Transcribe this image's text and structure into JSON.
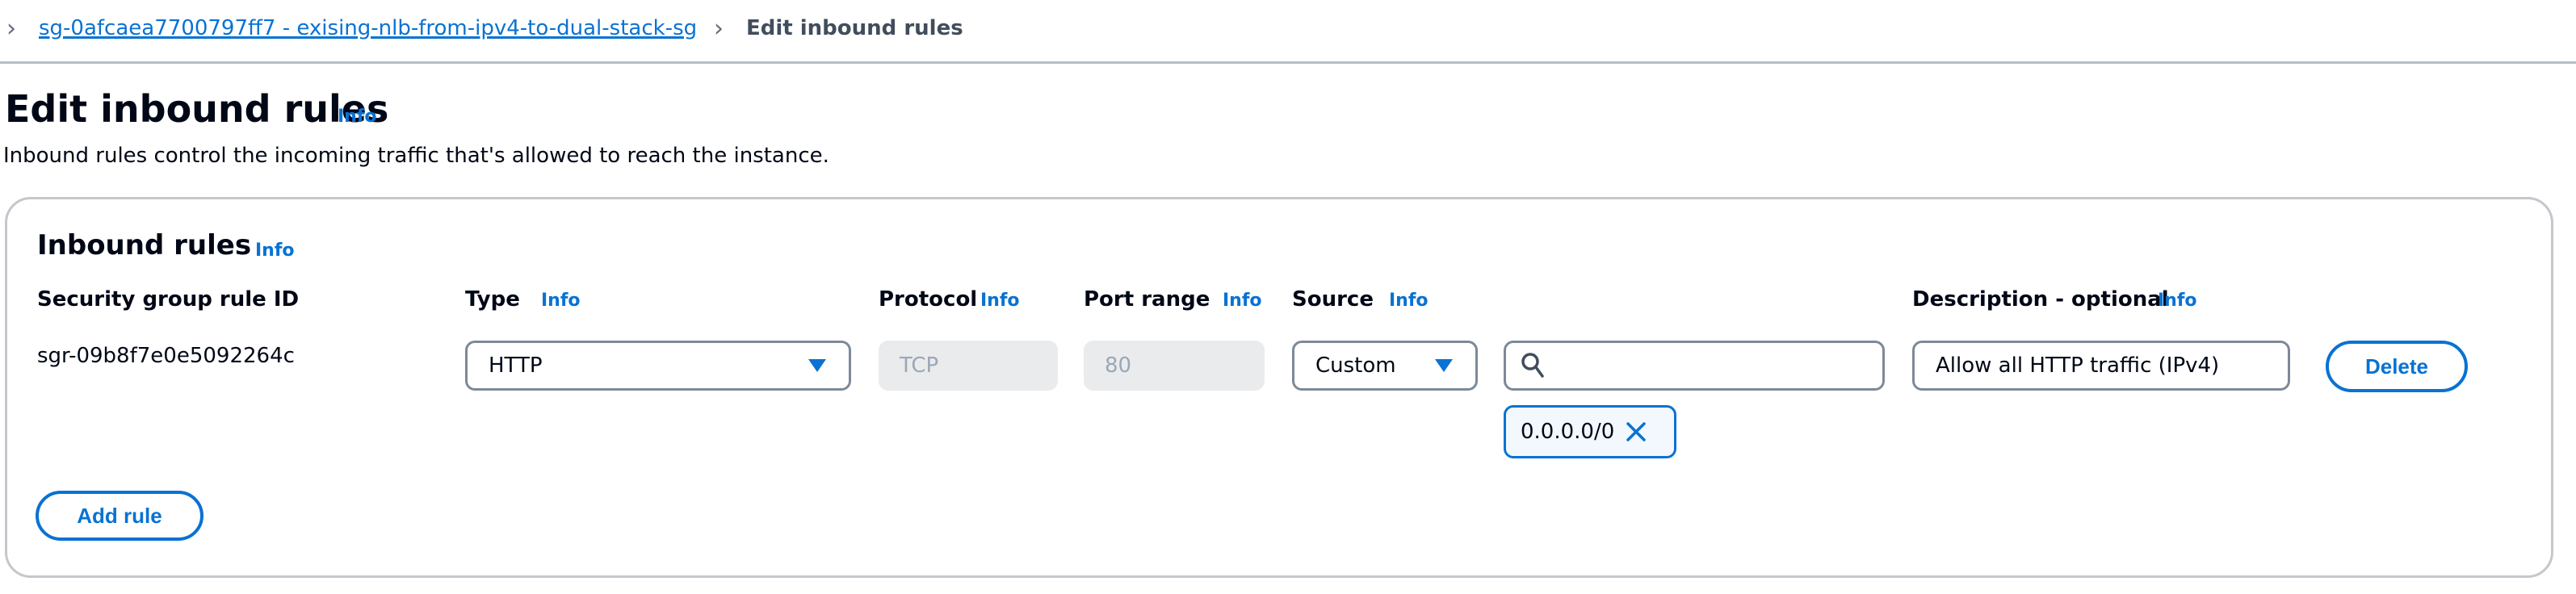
{
  "breadcrumb": {
    "parent": "sg-0afcaea7700797ff7 - exising-nlb-from-ipv4-to-dual-stack-sg",
    "current": "Edit inbound rules"
  },
  "page": {
    "title": "Edit inbound rules",
    "info": "Info",
    "description": "Inbound rules control the incoming traffic that's allowed to reach the instance."
  },
  "panel": {
    "title": "Inbound rules",
    "info": "Info",
    "columns": {
      "rule_id": "Security group rule ID",
      "type": "Type",
      "protocol": "Protocol",
      "port_range": "Port range",
      "source": "Source",
      "description": "Description - optional",
      "info": "Info"
    },
    "rows": [
      {
        "rule_id": "sgr-09b8f7e0e5092264c",
        "type": "HTTP",
        "protocol": "TCP",
        "port_range": "80",
        "source": "Custom",
        "search_value": "",
        "cidr": "0.0.0.0/0",
        "description": "Allow all HTTP traffic (IPv4)",
        "delete_label": "Delete"
      }
    ],
    "add_rule_label": "Add rule"
  },
  "colors": {
    "accent": "#0972d3",
    "text": "#000716",
    "disabled_bg": "#e9ebed"
  }
}
